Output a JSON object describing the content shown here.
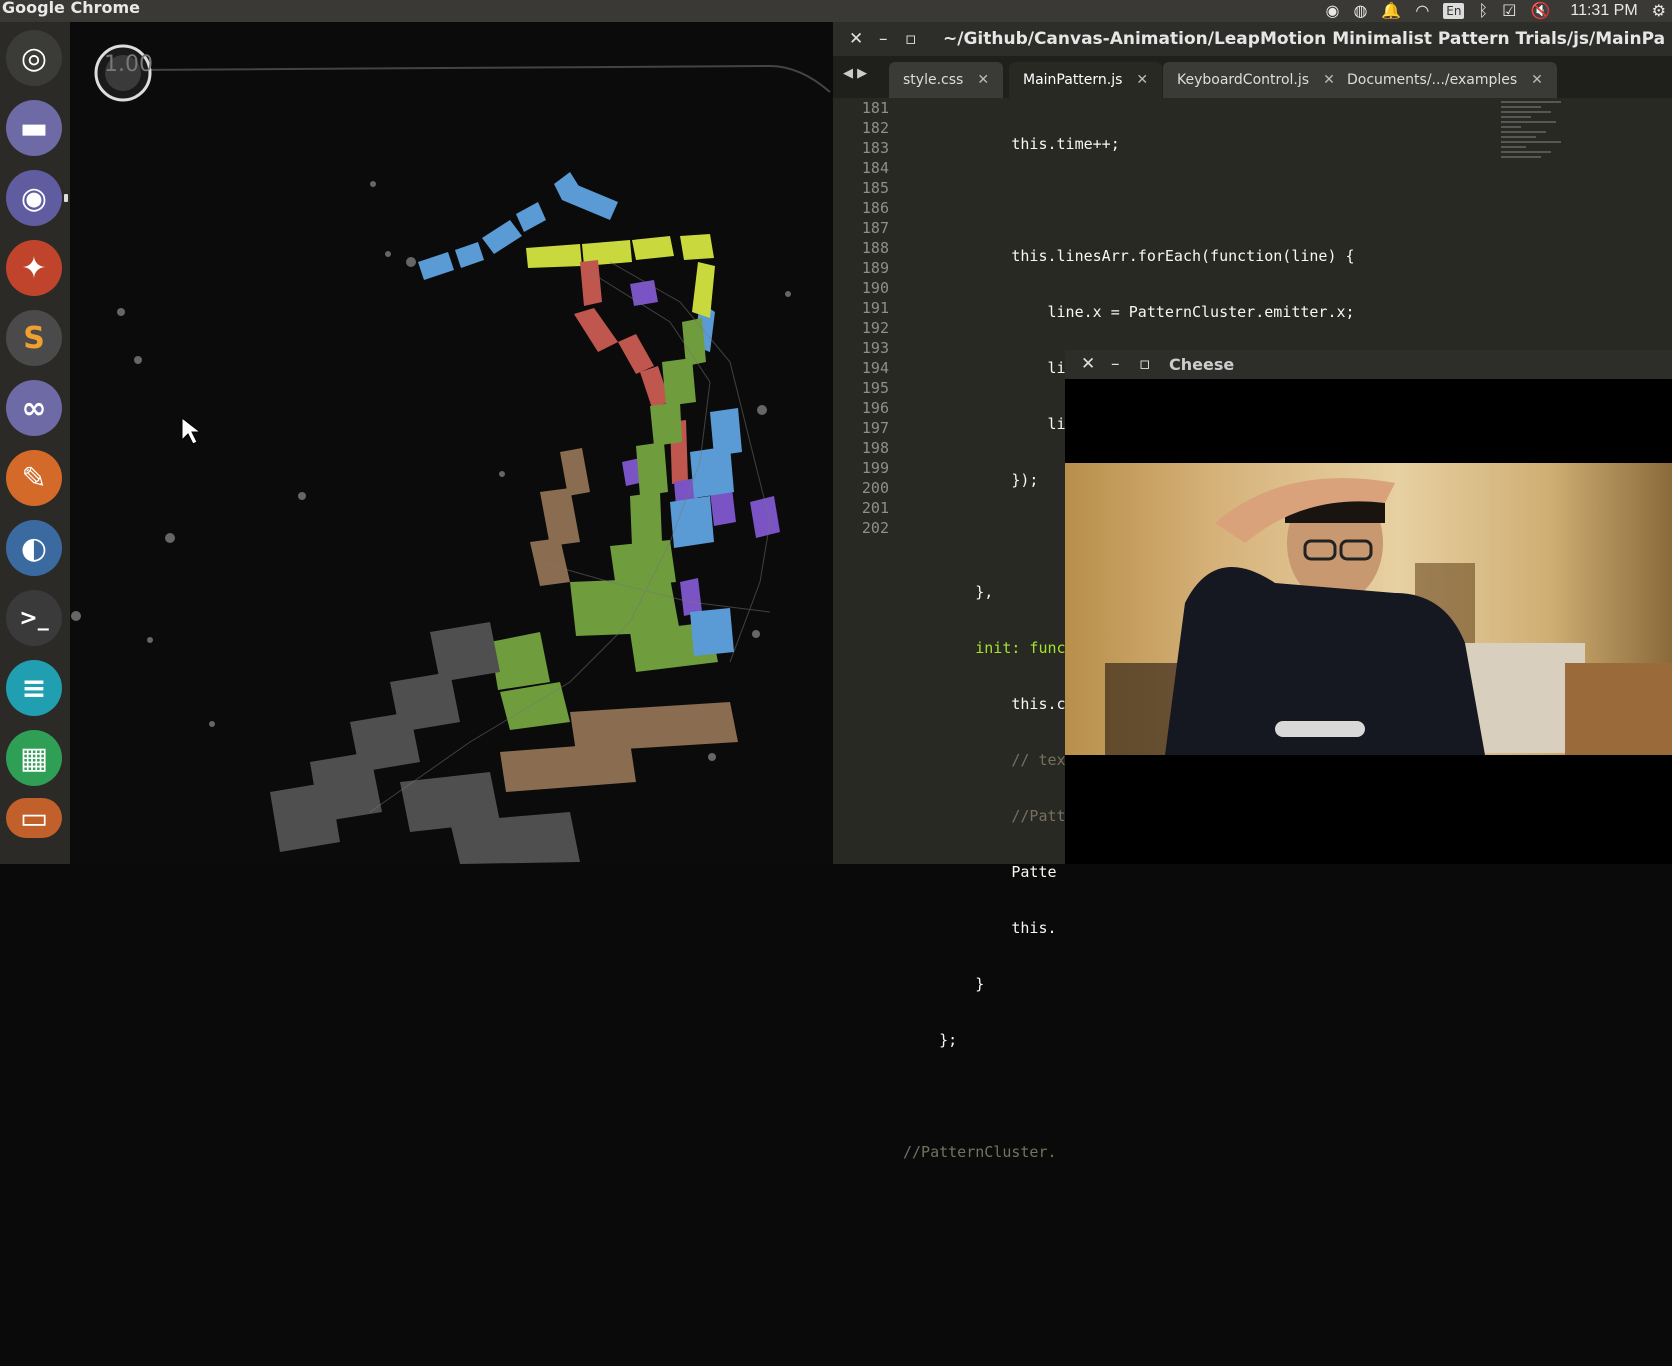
{
  "topbar": {
    "app_title": "Google Chrome",
    "keyboard_layout": "En",
    "clock": "11:31 PM",
    "icons": [
      "camera-icon",
      "chrome-icon",
      "bell-icon",
      "wifi-icon",
      "keyboard-icon",
      "bluetooth-icon",
      "checkbox-icon",
      "volume-mute-icon",
      "gear-icon"
    ]
  },
  "launcher": {
    "items": [
      {
        "name": "ubuntu-dash",
        "glyph": "◎",
        "color": "#3b3b38"
      },
      {
        "name": "files",
        "glyph": "▬",
        "color": "#6d6aa6"
      },
      {
        "name": "chrome",
        "glyph": "◉",
        "color": "#5f5ca0"
      },
      {
        "name": "firefox",
        "glyph": "✦",
        "color": "#c0442b"
      },
      {
        "name": "sublime-text",
        "glyph": "S",
        "color": "#4a4a4a"
      },
      {
        "name": "swirl-app",
        "glyph": "∞",
        "color": "#6d6aa6"
      },
      {
        "name": "gimp",
        "glyph": "✎",
        "color": "#d46a2a"
      },
      {
        "name": "blender",
        "glyph": "◐",
        "color": "#3a6aa0"
      },
      {
        "name": "terminal",
        "glyph": ">_",
        "color": "#3a3a3a"
      },
      {
        "name": "text-editor",
        "glyph": "≡",
        "color": "#1f9fb0"
      },
      {
        "name": "spreadsheet",
        "glyph": "▦",
        "color": "#2f9f55"
      },
      {
        "name": "more",
        "glyph": "▭",
        "color": "#c2602b"
      }
    ]
  },
  "canvas": {
    "fps": "1.00"
  },
  "editor": {
    "window_title": "~/Github/Canvas-Animation/LeapMotion Minimalist Pattern Trials/js/MainPa",
    "tabs": [
      {
        "label": "style.css",
        "active": false
      },
      {
        "label": "MainPattern.js",
        "active": true
      },
      {
        "label": "KeyboardControl.js",
        "active": false
      },
      {
        "label": "Documents/.../examples",
        "active": false
      }
    ],
    "line_numbers": [
      "181",
      "182",
      "183",
      "184",
      "185",
      "186",
      "187",
      "188",
      "189",
      "190",
      "191",
      "192",
      "193",
      "194",
      "195",
      "196",
      "197",
      "198",
      "199",
      "200",
      "201",
      "202"
    ],
    "code_lines": [
      "            this.time++;",
      "",
      "            this.linesArr.forEach(function(line) {",
      "                line.x = PatternCluster.emitter.x;",
      "                line.y = PatternCluster.emitter.y;",
      "                line.draw(PatternCluster.time);",
      "            });",
      "",
      "        },",
      "        init: function() {",
      "            this.createLines();",
      "            // texture of the Lines, 'xor' darker' or 'lighter'",
      "            //PatternCxt.globalCompositeOperation = 'xor';",
      "            Patte",
      "            this.",
      "        }",
      "    };",
      "",
      "//PatternCluster.",
      "",
      "",
      ""
    ]
  },
  "cheese": {
    "title": "Cheese"
  },
  "colors": {
    "blue": "#5b9bd5",
    "yellow": "#c9d83c",
    "red": "#c0574e",
    "purple": "#7a53c4",
    "green": "#6f9c3c",
    "tan": "#8a6d50",
    "gray": "#555555"
  }
}
